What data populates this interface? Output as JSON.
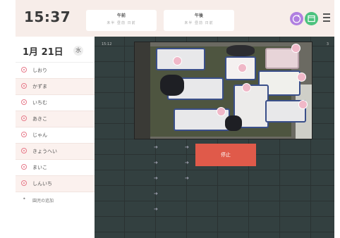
{
  "header": {
    "time": "15:37",
    "morning": {
      "title": "午前",
      "sub": "未半 昼前 日前"
    },
    "afternoon": {
      "title": "午後",
      "sub": "未半 昼前 日前"
    }
  },
  "icons": {
    "sleep": "sleep-face-icon",
    "calendar": "calendar-icon",
    "menu": "hamburger-menu-icon"
  },
  "colors": {
    "accent_purple": "#b07fe0",
    "accent_green": "#4cc27e",
    "stop_red": "#e05a4a",
    "marker_pink": "#f0b8c8"
  },
  "sidebar": {
    "date": "1月 21日",
    "weekday": "水",
    "children": [
      {
        "name": "しおり"
      },
      {
        "name": "かずま"
      },
      {
        "name": "いちむ"
      },
      {
        "name": "あきこ"
      },
      {
        "name": "じゃん"
      },
      {
        "name": "きょうへい"
      },
      {
        "name": "まいこ"
      },
      {
        "name": "しんいち"
      }
    ],
    "add_label": "園児の追加"
  },
  "grid": {
    "time_left": "15:12",
    "time_right": "3"
  },
  "stop_button": "停止"
}
